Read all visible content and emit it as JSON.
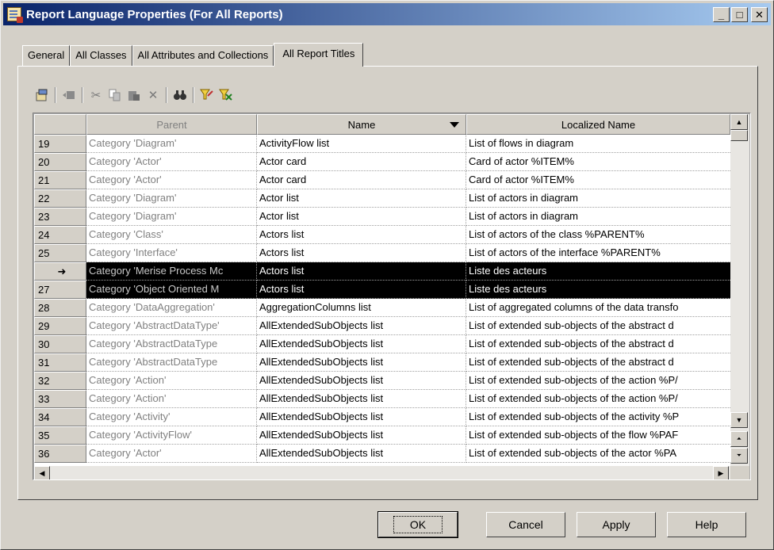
{
  "window": {
    "title": "Report Language Properties (For All Reports)",
    "controls": {
      "minimize": "_",
      "maximize": "□",
      "close": "✕"
    }
  },
  "tabs": [
    {
      "label": "General",
      "active": false
    },
    {
      "label": "All Classes",
      "active": false
    },
    {
      "label": "All Attributes and Collections",
      "active": false
    },
    {
      "label": "All Report Titles",
      "active": true
    }
  ],
  "toolbar": {
    "icons": [
      "properties-icon",
      "insert-row-icon",
      "cut-icon",
      "copy-icon",
      "paste-icon",
      "delete-icon",
      "find-icon",
      "filter-icon",
      "filter-options-icon"
    ]
  },
  "grid": {
    "columns": [
      {
        "label": ""
      },
      {
        "label": "Parent"
      },
      {
        "label": "Name"
      },
      {
        "label": "Localized Name"
      }
    ],
    "rows": [
      {
        "num": "19",
        "parent": "Category 'Diagram'",
        "name": "ActivityFlow list",
        "localized": "List of flows in diagram"
      },
      {
        "num": "20",
        "parent": "Category 'Actor'",
        "name": "Actor card",
        "localized": "Card of actor %ITEM%"
      },
      {
        "num": "21",
        "parent": "Category 'Actor'",
        "name": "Actor card",
        "localized": "Card of actor %ITEM%"
      },
      {
        "num": "22",
        "parent": "Category 'Diagram'",
        "name": "Actor list",
        "localized": "List of actors in diagram"
      },
      {
        "num": "23",
        "parent": "Category 'Diagram'",
        "name": "Actor list",
        "localized": "List of actors in diagram"
      },
      {
        "num": "24",
        "parent": "Category 'Class'",
        "name": "Actors list",
        "localized": "List of actors of the class %PARENT%"
      },
      {
        "num": "25",
        "parent": "Category 'Interface'",
        "name": "Actors list",
        "localized": "List of actors of the interface %PARENT%"
      },
      {
        "num": "➜",
        "parent": "Category 'Merise Process Mc",
        "name": "Actors list",
        "localized": "Liste des acteurs"
      },
      {
        "num": "27",
        "parent": "Category 'Object Oriented M",
        "name": "Actors list",
        "localized": "Liste des acteurs"
      },
      {
        "num": "28",
        "parent": "Category 'DataAggregation'",
        "name": "AggregationColumns list",
        "localized": "List of aggregated columns of the data transfo"
      },
      {
        "num": "29",
        "parent": "Category 'AbstractDataType'",
        "name": "AllExtendedSubObjects list",
        "localized": "List of extended sub-objects of the abstract d"
      },
      {
        "num": "30",
        "parent": "Category 'AbstractDataType",
        "name": "AllExtendedSubObjects list",
        "localized": "List of extended sub-objects of the abstract d"
      },
      {
        "num": "31",
        "parent": "Category 'AbstractDataType",
        "name": "AllExtendedSubObjects list",
        "localized": "List of extended sub-objects of the abstract d"
      },
      {
        "num": "32",
        "parent": "Category 'Action'",
        "name": "AllExtendedSubObjects list",
        "localized": "List of extended sub-objects of the action %P/"
      },
      {
        "num": "33",
        "parent": "Category 'Action'",
        "name": "AllExtendedSubObjects list",
        "localized": "List of extended sub-objects of the action %P/"
      },
      {
        "num": "34",
        "parent": "Category 'Activity'",
        "name": "AllExtendedSubObjects list",
        "localized": "List of extended sub-objects of the activity %P"
      },
      {
        "num": "35",
        "parent": "Category 'ActivityFlow'",
        "name": "AllExtendedSubObjects list",
        "localized": "List of extended sub-objects of the flow %PAF"
      },
      {
        "num": "36",
        "parent": "Category 'Actor'",
        "name": "AllExtendedSubObjects list",
        "localized": "List of extended sub-objects of the actor %PA"
      }
    ]
  },
  "buttons": {
    "ok": "OK",
    "cancel": "Cancel",
    "apply": "Apply",
    "help": "Help"
  }
}
